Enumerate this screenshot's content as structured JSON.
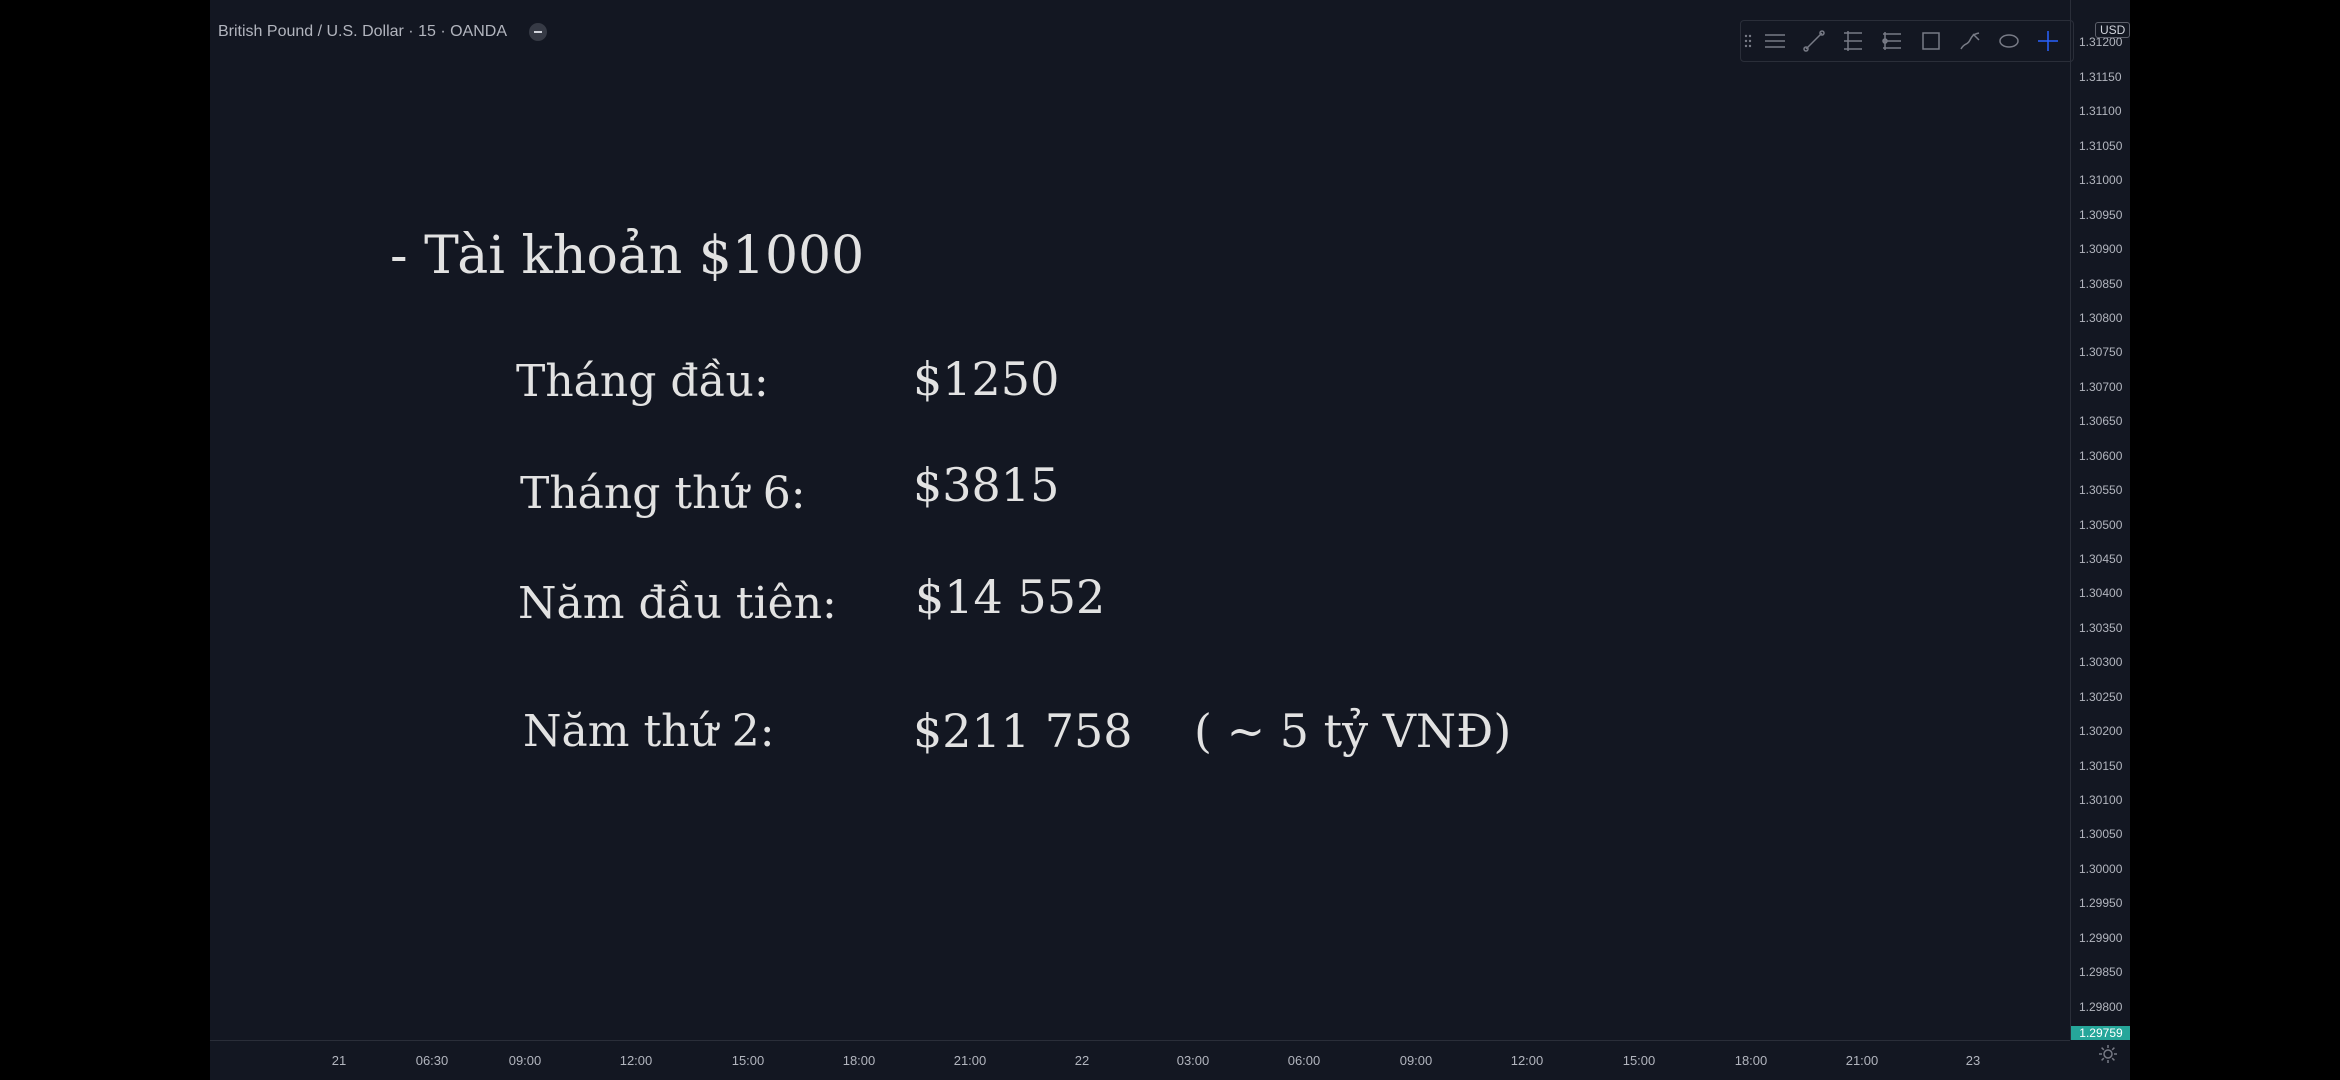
{
  "header": {
    "symbol_title": "British Pound / U.S. Dollar · 15 · OANDA"
  },
  "toolbar": {
    "tools": [
      "drag-grip-icon",
      "horizontal-lines-icon",
      "trend-line-icon",
      "fib-retracement-icon",
      "pitchfork-icon",
      "rectangle-icon",
      "brush-icon",
      "ellipse-icon",
      "crosshair-icon"
    ]
  },
  "price_axis": {
    "currency": "USD",
    "labels": [
      "1.31200",
      "1.31150",
      "1.31100",
      "1.31050",
      "1.31000",
      "1.30950",
      "1.30900",
      "1.30850",
      "1.30800",
      "1.30750",
      "1.30700",
      "1.30650",
      "1.30600",
      "1.30550",
      "1.30500",
      "1.30450",
      "1.30400",
      "1.30350",
      "1.30300",
      "1.30250",
      "1.30200",
      "1.30150",
      "1.30100",
      "1.30050",
      "1.30000",
      "1.29950",
      "1.29900",
      "1.29850",
      "1.29800"
    ],
    "last_price": "1.29759",
    "last_price_color": "#26a69a"
  },
  "time_axis": {
    "labels": [
      "21",
      "06:30",
      "09:00",
      "12:00",
      "15:00",
      "18:00",
      "21:00",
      "22",
      "03:00",
      "06:00",
      "09:00",
      "12:00",
      "15:00",
      "18:00",
      "21:00",
      "23"
    ]
  },
  "slide": {
    "title": "- Tài khoản $1000",
    "rows": [
      {
        "label": "Tháng đầu:",
        "value": "$1250"
      },
      {
        "label": "Tháng thứ 6:",
        "value": "$3815"
      },
      {
        "label": "Năm đầu tiên:",
        "value": "$14 552"
      },
      {
        "label": "Năm thứ 2:",
        "value": "$211 758",
        "note": "( ~ 5 tỷ VNĐ)"
      }
    ]
  }
}
